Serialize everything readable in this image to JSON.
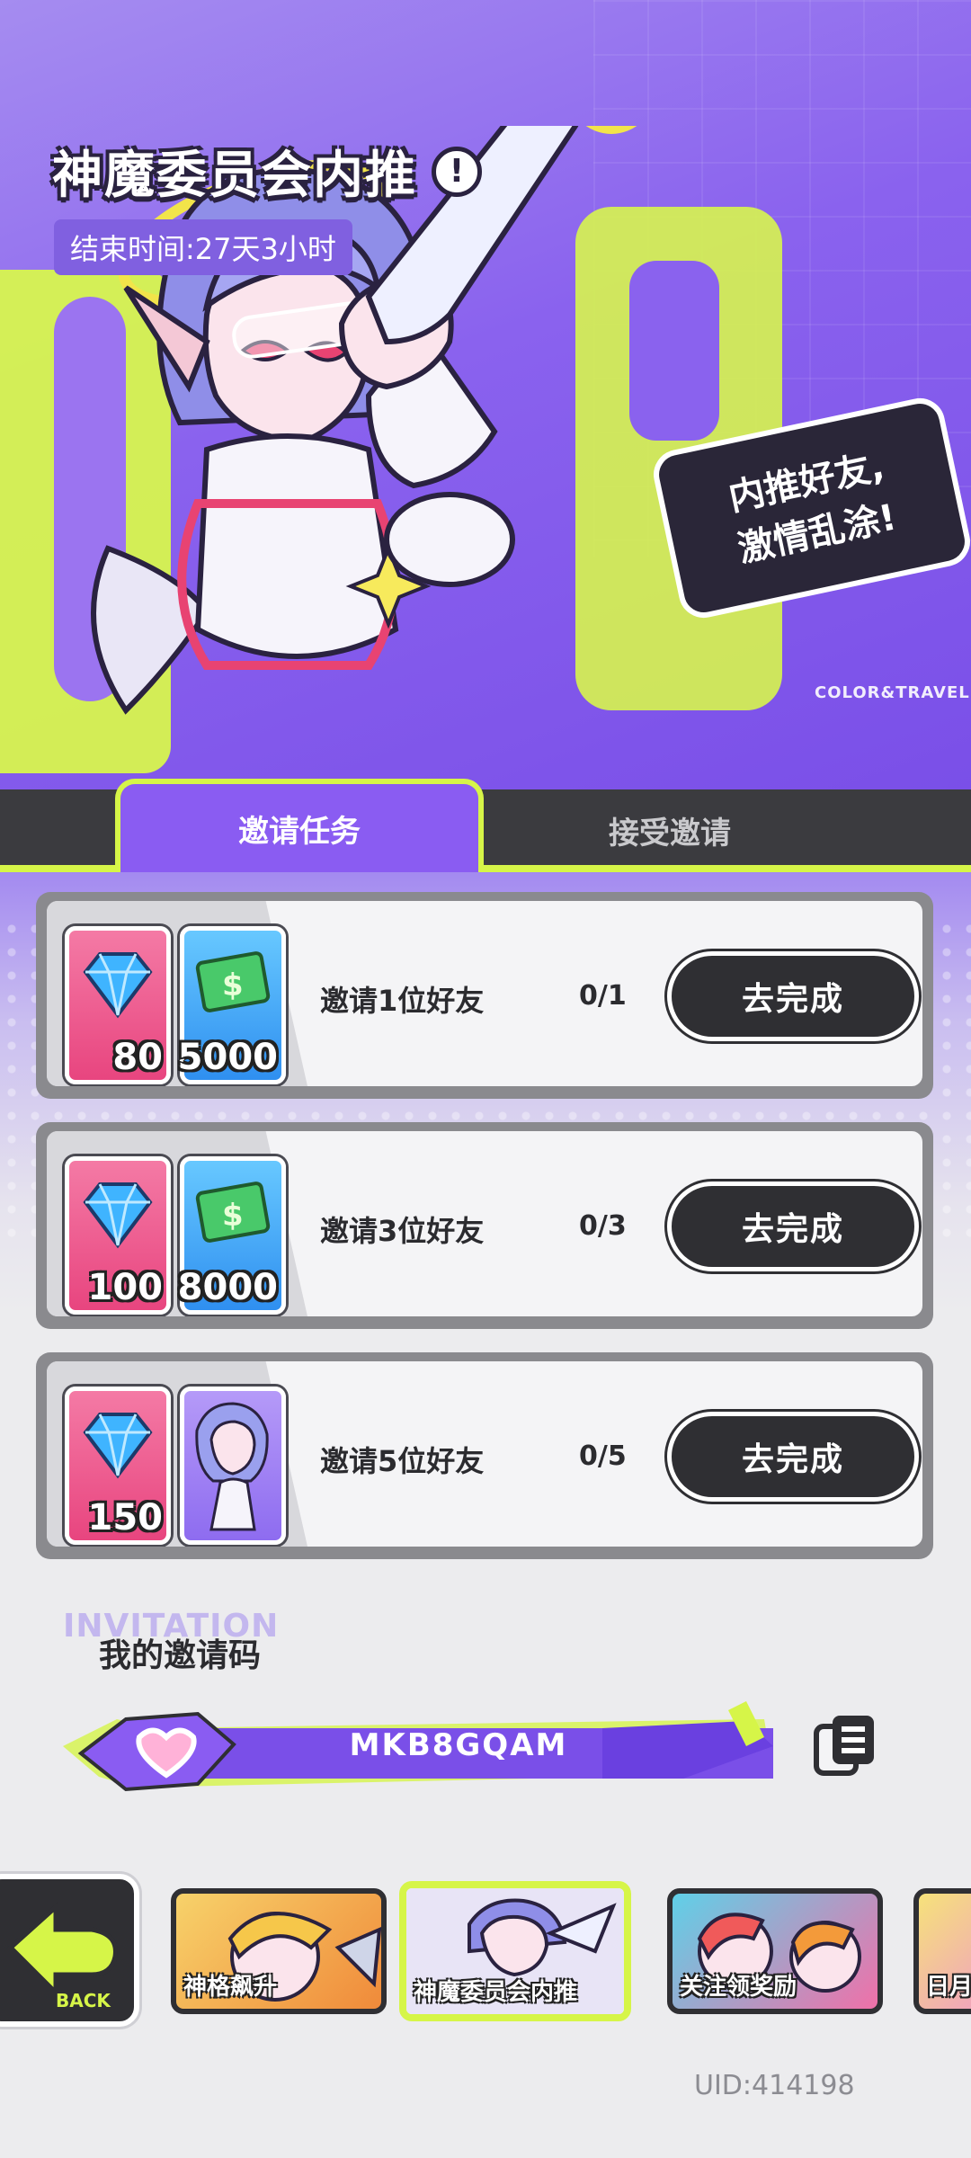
{
  "header": {
    "title": "神魔委员会内推",
    "info_icon": "exclamation-icon",
    "end_time": "结束时间:27天3小时",
    "speech_line1": "内推好友,",
    "speech_line2": "激情乱涂!",
    "brand": "COLOR&TRAVEL"
  },
  "tabs": [
    {
      "label": "邀请任务",
      "active": true
    },
    {
      "label": "接受邀请",
      "active": false
    }
  ],
  "tasks": [
    {
      "label": "邀请1位好友",
      "progress": "0/1",
      "button": "去完成",
      "rewards": [
        {
          "icon": "diamond-icon",
          "qty": "80"
        },
        {
          "icon": "cash-icon",
          "qty": "5000"
        }
      ]
    },
    {
      "label": "邀请3位好友",
      "progress": "0/3",
      "button": "去完成",
      "rewards": [
        {
          "icon": "diamond-icon",
          "qty": "100"
        },
        {
          "icon": "cash-icon",
          "qty": "8000"
        }
      ]
    },
    {
      "label": "邀请5位好友",
      "progress": "0/5",
      "button": "去完成",
      "rewards": [
        {
          "icon": "diamond-icon",
          "qty": "150"
        },
        {
          "icon": "character-portrait-icon",
          "qty": ""
        }
      ]
    }
  ],
  "invite": {
    "bg_word": "INVITATION",
    "title": "我的邀请码",
    "code": "MKB8GQAM",
    "copy_icon": "copy-icon"
  },
  "bottom_nav": {
    "back_label": "BACK",
    "items": [
      {
        "label": "神格飙升",
        "active": false
      },
      {
        "label": "神魔委员会内推",
        "active": true
      },
      {
        "label": "关注领奖励",
        "active": false
      },
      {
        "label": "日月",
        "active": false
      }
    ]
  },
  "uid": "UID:414198",
  "colors": {
    "accent": "#8a5cf2",
    "lime": "#d6f548",
    "dark": "#2f2f33",
    "pink": "#e8457f",
    "blue": "#2f8ff0"
  }
}
